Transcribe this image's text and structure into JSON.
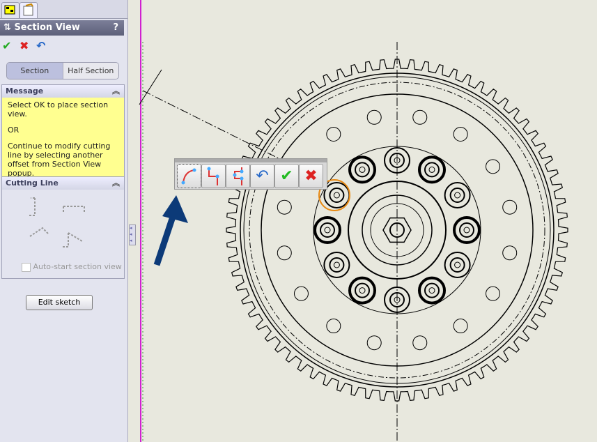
{
  "panel": {
    "tabs": [
      {
        "icon": "feature-manager-icon"
      },
      {
        "icon": "property-manager-icon"
      }
    ],
    "title": "Section View",
    "help": "?",
    "actions": {
      "ok": "ok-icon",
      "cancel": "cancel-icon",
      "undo": "undo-icon"
    },
    "segments": [
      {
        "label": "Section",
        "selected": true
      },
      {
        "label": "Half Section",
        "selected": false
      }
    ],
    "message": {
      "header": "Message",
      "lines": [
        "Select OK to place section view.",
        "OR",
        "Continue to modify cutting line by selecting another offset from Section View popup."
      ]
    },
    "cutting_line": {
      "header": "Cutting Line",
      "options": [
        "single-offset-icon",
        "double-offset-icon",
        "arc-offset-icon",
        "notch-offset-icon"
      ],
      "checkbox_label": "Auto-start section view",
      "checkbox_checked": false
    },
    "edit_sketch": "Edit sketch"
  },
  "popup": {
    "buttons": [
      "arc-offset-icon",
      "single-offset-icon",
      "notch-offset-icon",
      "undo-icon",
      "ok-icon",
      "cancel-icon"
    ]
  },
  "colors": {
    "accent": "#0c3a78",
    "highlight": "#e88a14",
    "message_bg": "#ffff90"
  }
}
